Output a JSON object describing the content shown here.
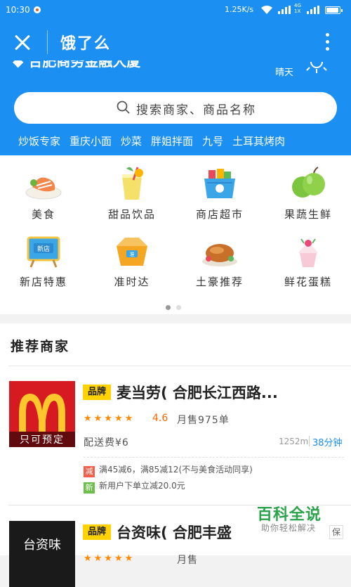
{
  "status_bar": {
    "time": "10:30",
    "speed": "1.25K/s",
    "network": "4G",
    "network_sub": "1X"
  },
  "header": {
    "title": "饿了么",
    "address_partial": "合肥商务金融大厦",
    "weather": "晴天"
  },
  "search": {
    "placeholder": "搜索商家、商品名称"
  },
  "hot_words": [
    "炒饭专家",
    "重庆小面",
    "炒菜",
    "胖姐拌面",
    "九号",
    "土耳其烤肉"
  ],
  "categories": [
    {
      "label": "美食",
      "icon": "salmon-dish-icon"
    },
    {
      "label": "甜品饮品",
      "icon": "juice-cup-icon"
    },
    {
      "label": "商店超市",
      "icon": "shopping-basket-icon"
    },
    {
      "label": "果蔬生鲜",
      "icon": "green-apple-icon"
    },
    {
      "label": "新店特惠",
      "icon": "new-shop-sign-icon"
    },
    {
      "label": "准时达",
      "icon": "on-time-box-icon"
    },
    {
      "label": "土豪推荐",
      "icon": "roast-chicken-icon"
    },
    {
      "label": "鲜花蛋糕",
      "icon": "cupcake-icon"
    }
  ],
  "pager": {
    "count": 2,
    "active": 1
  },
  "recommend": {
    "title": "推荐商家",
    "shops": [
      {
        "brand_tag": "品牌",
        "name": "麦当劳(  合肥长江西路...",
        "logo_caption": "只可预定",
        "stars": "★★★★★",
        "rating": "4.6",
        "monthly_sales": "月售975单",
        "delivery_fee": "配送费¥6",
        "distance": "1252m",
        "time": "38分钟",
        "promos": [
          {
            "badge": "减",
            "color": "#f35f4a",
            "text": "满45减6，满85减12(不与美食活动同享)"
          },
          {
            "badge": "新",
            "color": "#6cc04a",
            "text": "新用户下单立减20.0元"
          }
        ]
      },
      {
        "brand_tag": "品牌",
        "name": "台资味(  合肥丰盛",
        "logo_caption": "台资味",
        "stars": "★★★★★",
        "monthly_sales": "月售"
      }
    ]
  },
  "watermark": {
    "title": "百科全说",
    "subtitle": "助你轻松解决"
  },
  "side_tag": "保"
}
